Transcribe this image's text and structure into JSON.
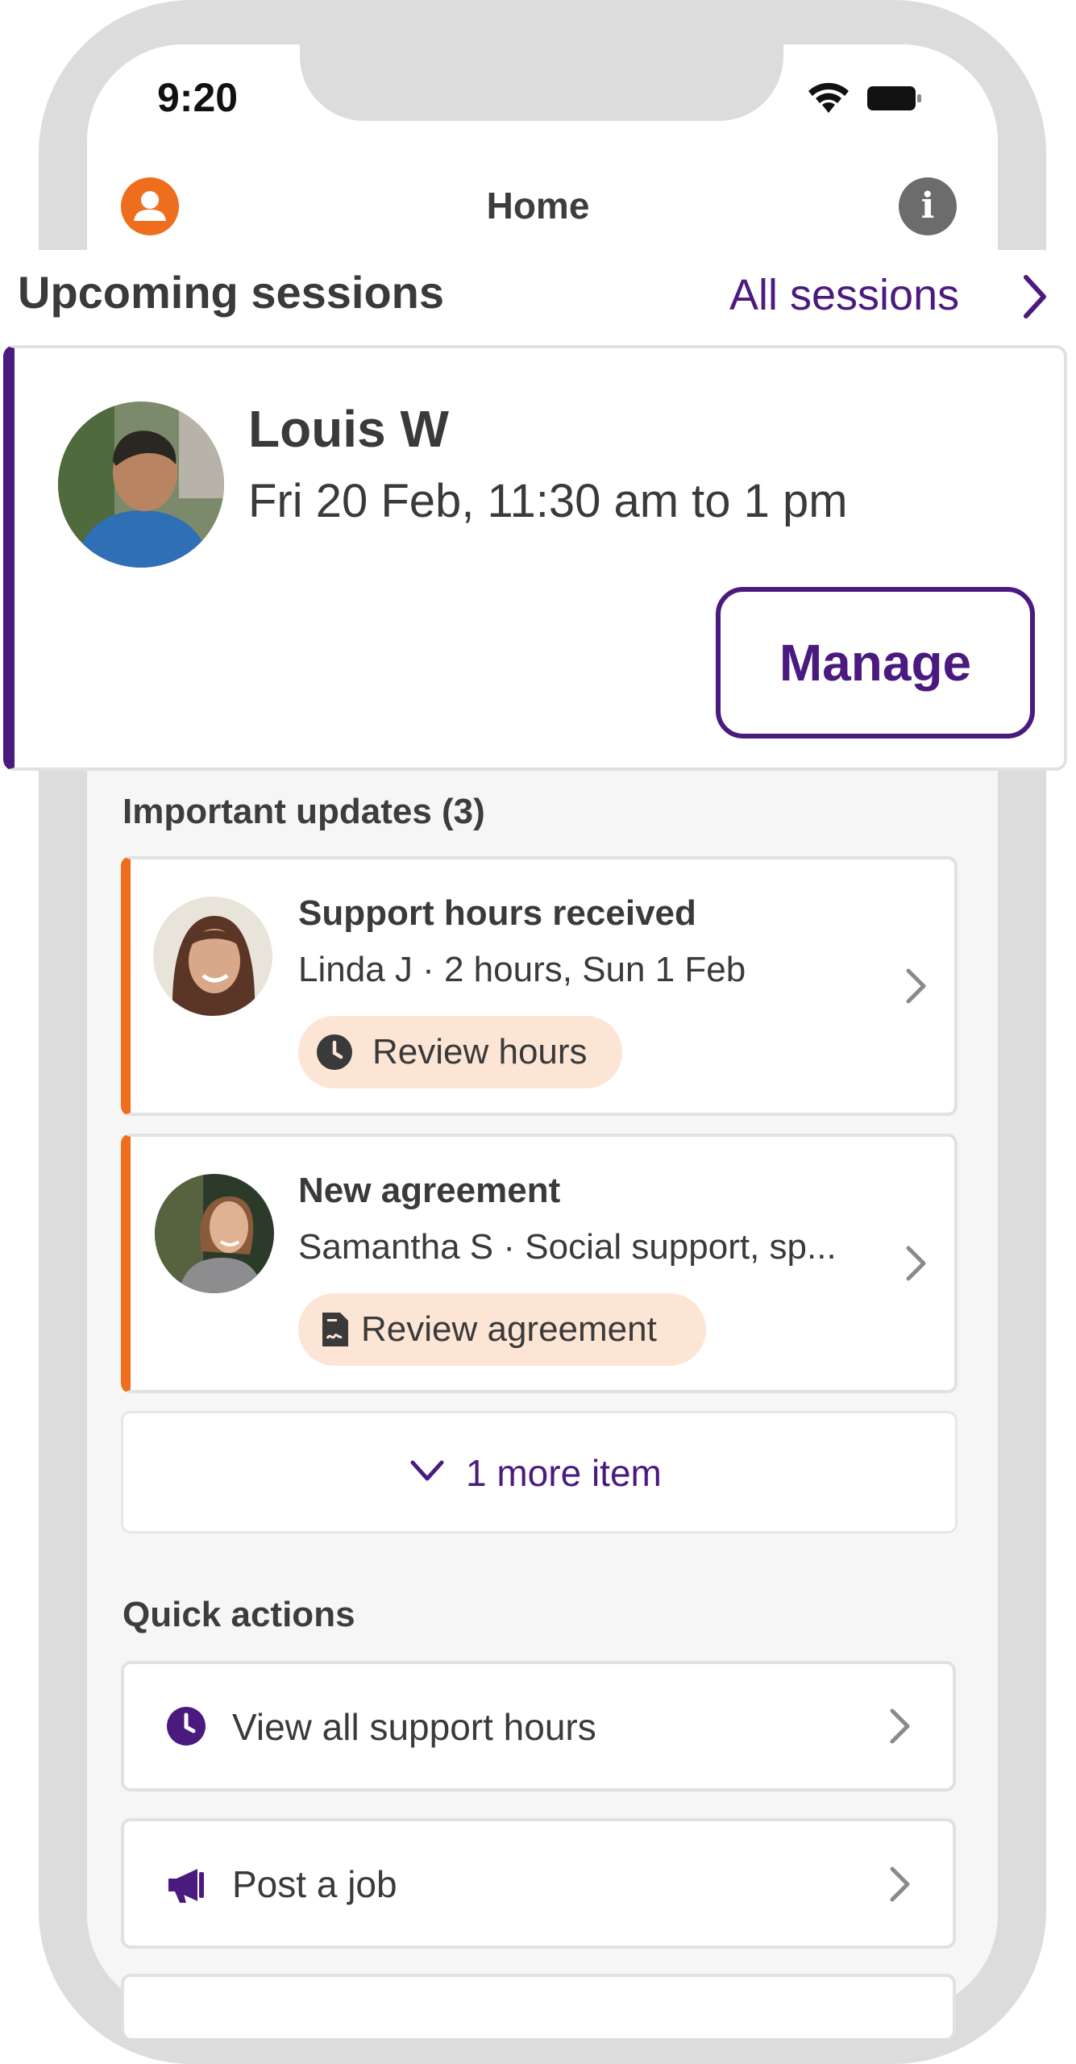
{
  "status_bar": {
    "time": "9:20"
  },
  "header": {
    "title": "Home",
    "profile_icon": "person-icon",
    "info_icon": "info-icon"
  },
  "upcoming": {
    "title": "Upcoming sessions",
    "all_sessions_label": "All sessions",
    "session": {
      "name": "Louis W",
      "time": "Fri 20 Feb, 11:30 am to 1 pm",
      "manage_label": "Manage"
    }
  },
  "updates": {
    "title": "Important updates (3)",
    "items": [
      {
        "title": "Support hours received",
        "subtitle": "Linda J · 2 hours, Sun 1 Feb",
        "action": "Review hours",
        "icon": "clock-icon"
      },
      {
        "title": "New agreement",
        "subtitle": "Samantha S · Social support, sp...",
        "action": "Review agreement",
        "icon": "document-signature-icon"
      }
    ],
    "more_label": "1 more item"
  },
  "quick_actions": {
    "title": "Quick actions",
    "items": [
      {
        "label": "View all support hours",
        "icon": "clock-icon"
      },
      {
        "label": "Post a job",
        "icon": "megaphone-icon"
      }
    ]
  },
  "colors": {
    "brand_purple": "#4b1a7f",
    "accent_orange": "#ee6e1e",
    "pill_bg": "#fde5d6"
  }
}
